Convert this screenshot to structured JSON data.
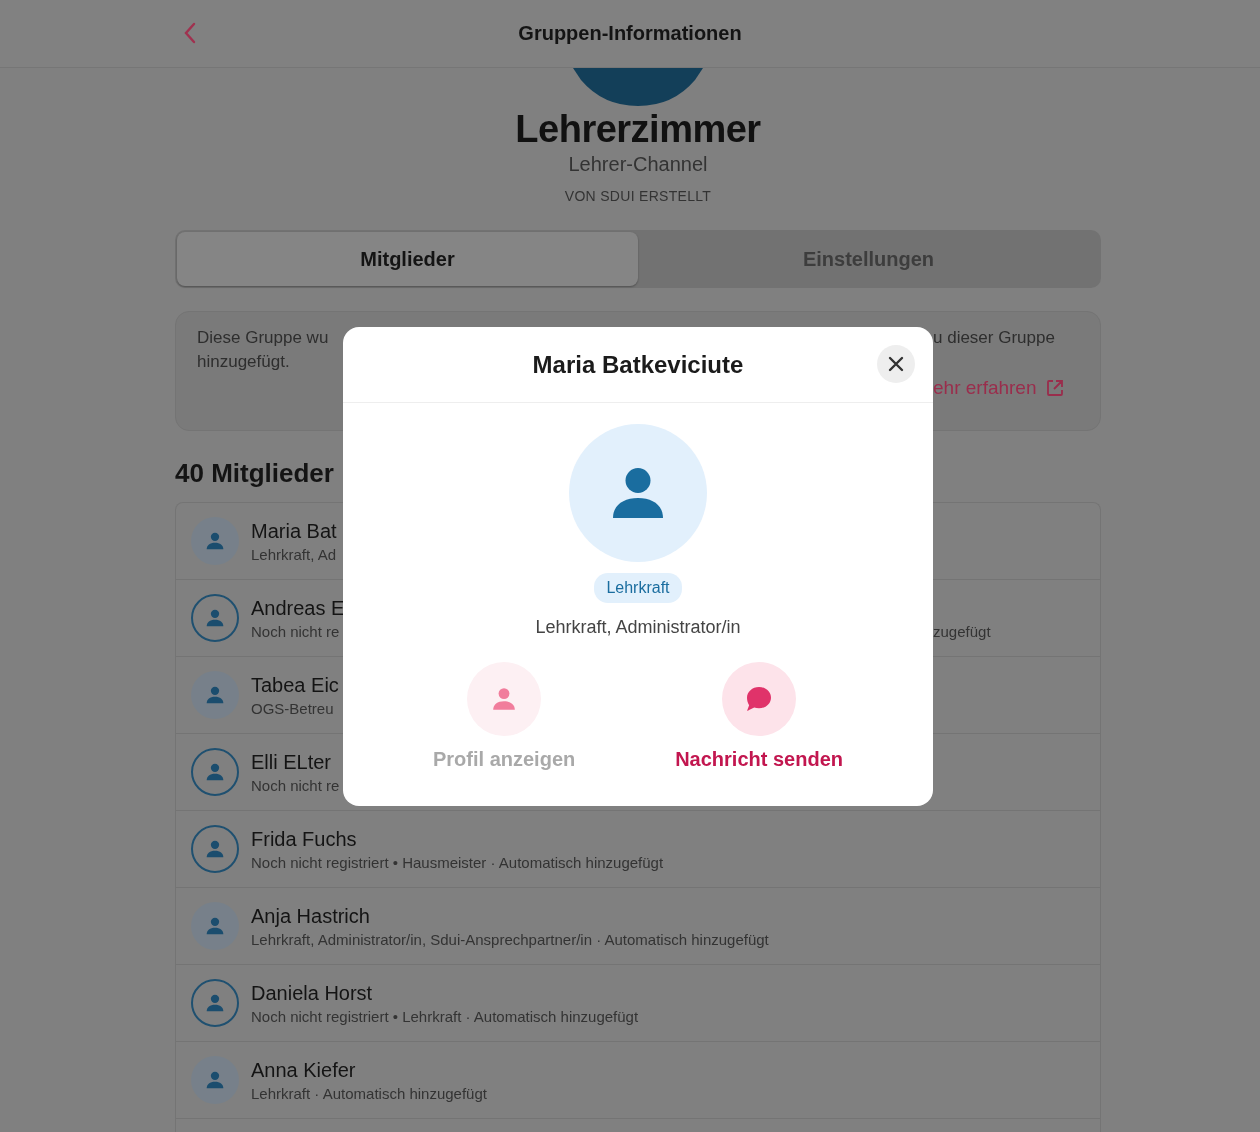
{
  "header": {
    "title": "Gruppen-Informationen"
  },
  "group": {
    "name": "Lehrerzimmer",
    "type": "Lehrer-Channel",
    "creator": "VON SDUI ERSTELLT"
  },
  "tabs": [
    {
      "label": "Mitglieder",
      "selected": true
    },
    {
      "label": "Einstellungen",
      "selected": false
    }
  ],
  "info": {
    "left_lines": [
      "Diese Gruppe wu",
      "hinzugefügt."
    ],
    "right_text": "u dieser Gruppe",
    "link": "ehr erfahren"
  },
  "members_title": "40 Mitglieder",
  "members": [
    {
      "name": "Maria Bat",
      "subtitle": "Lehrkraft, Ad",
      "registered": true
    },
    {
      "name": "Andreas E",
      "subtitle": "Noch nicht re",
      "subtitle_right": "zugefügt",
      "registered": false
    },
    {
      "name": "Tabea Eic",
      "subtitle": "OGS-Betreu",
      "registered": true
    },
    {
      "name": "Elli ELter",
      "subtitle": "Noch nicht re",
      "registered": false
    },
    {
      "name": "Frida Fuchs",
      "subtitle": "Noch nicht registriert • Hausmeister · Automatisch hinzugefügt",
      "registered": false
    },
    {
      "name": "Anja Hastrich",
      "subtitle": "Lehrkraft, Administrator/in, Sdui-Ansprechpartner/in · Automatisch hinzugefügt",
      "registered": true
    },
    {
      "name": "Daniela Horst",
      "subtitle": "Noch nicht registriert • Lehrkraft · Automatisch hinzugefügt",
      "registered": false
    },
    {
      "name": "Anna Kiefer",
      "subtitle": "Lehrkraft · Automatisch hinzugefügt",
      "registered": true
    }
  ],
  "dialog": {
    "title": "Maria Batkeviciute",
    "badge": "Lehrkraft",
    "roles": "Lehrkraft, Administrator/in",
    "actions": [
      {
        "kind": "profile",
        "label": "Profil anzeigen",
        "disabled": true
      },
      {
        "kind": "message",
        "label": "Nachricht senden",
        "disabled": false
      }
    ]
  }
}
